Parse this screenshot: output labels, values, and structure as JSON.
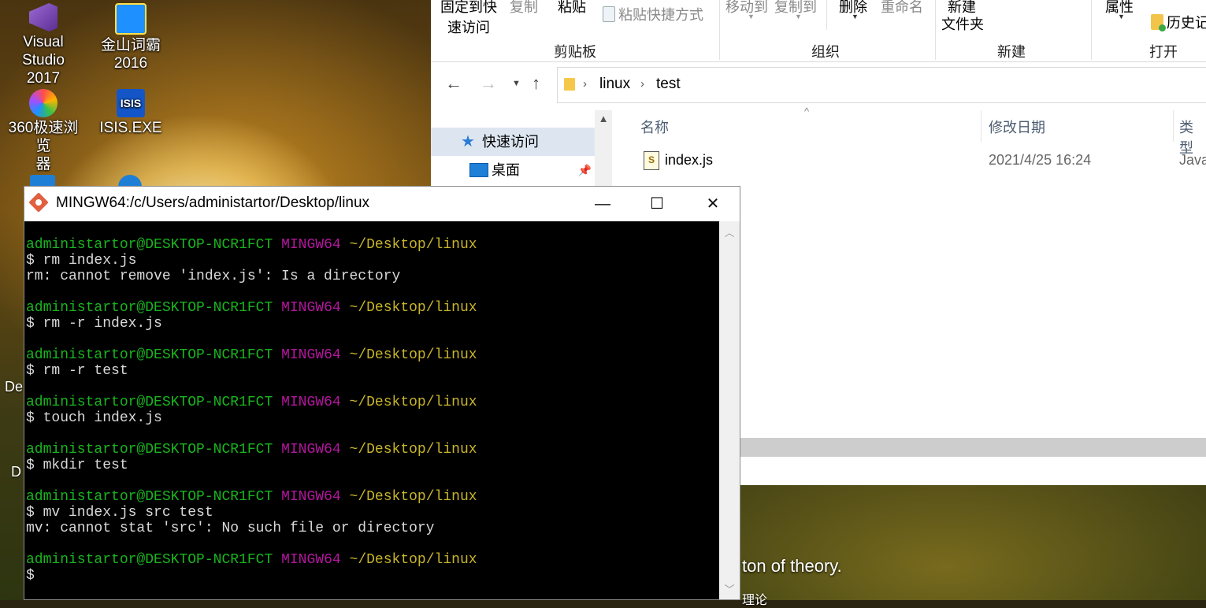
{
  "desktop": {
    "icons": [
      {
        "label_line1": "Visual",
        "label_line2": "Studio 2017"
      },
      {
        "label_line1": "金山词霸",
        "label_line2": "2016"
      },
      {
        "label_line1": "360极速浏览",
        "label_line2": "器"
      },
      {
        "label_line1": "ISIS.EXE",
        "label_line2": ""
      }
    ],
    "partial_labels": [
      "De",
      "D"
    ],
    "wallpaper_text": {
      "line1": "ton of theory.",
      "line2": "理论"
    }
  },
  "explorer": {
    "ribbon": {
      "pin_quick_access_line1": "固定到快",
      "pin_quick_access_line2": "速访问",
      "copy": "复制",
      "paste": "粘贴",
      "paste_shortcut": "粘贴快捷方式",
      "move_to": "移动到",
      "copy_to": "复制到",
      "delete": "删除",
      "rename": "重命名",
      "new_item": "新建",
      "new_folder": "文件夹",
      "properties": "属性",
      "history": "历史记",
      "groups": {
        "clipboard": "剪贴板",
        "organize": "组织",
        "new": "新建",
        "open": "打开"
      }
    },
    "address": {
      "crumbs": [
        "linux",
        "test"
      ]
    },
    "nav": {
      "quick_access": "快速访问",
      "desktop": "桌面"
    },
    "columns": {
      "name": "名称",
      "modified": "修改日期",
      "type": "类型"
    },
    "files": [
      {
        "name": "index.js",
        "modified": "2021/4/25 16:24",
        "type": "Java"
      }
    ]
  },
  "terminal": {
    "title": "MINGW64:/c/Users/administartor/Desktop/linux",
    "controls": {
      "minimize": "—",
      "maximize": "☐",
      "close": "✕"
    },
    "prompt": {
      "user": "administartor@DESKTOP-NCR1FCT",
      "shell": "MINGW64",
      "path": "~/Desktop/linux"
    },
    "entries": [
      {
        "command": "$ rm index.js",
        "output": "rm: cannot remove 'index.js': Is a directory"
      },
      {
        "command": "$ rm -r index.js",
        "output": ""
      },
      {
        "command": "$ rm -r test",
        "output": ""
      },
      {
        "command": "$ touch index.js",
        "output": ""
      },
      {
        "command": "$ mkdir test",
        "output": ""
      },
      {
        "command": "$ mv index.js src test",
        "output": "mv: cannot stat 'src': No such file or directory"
      },
      {
        "command": "$",
        "output": ""
      }
    ]
  }
}
